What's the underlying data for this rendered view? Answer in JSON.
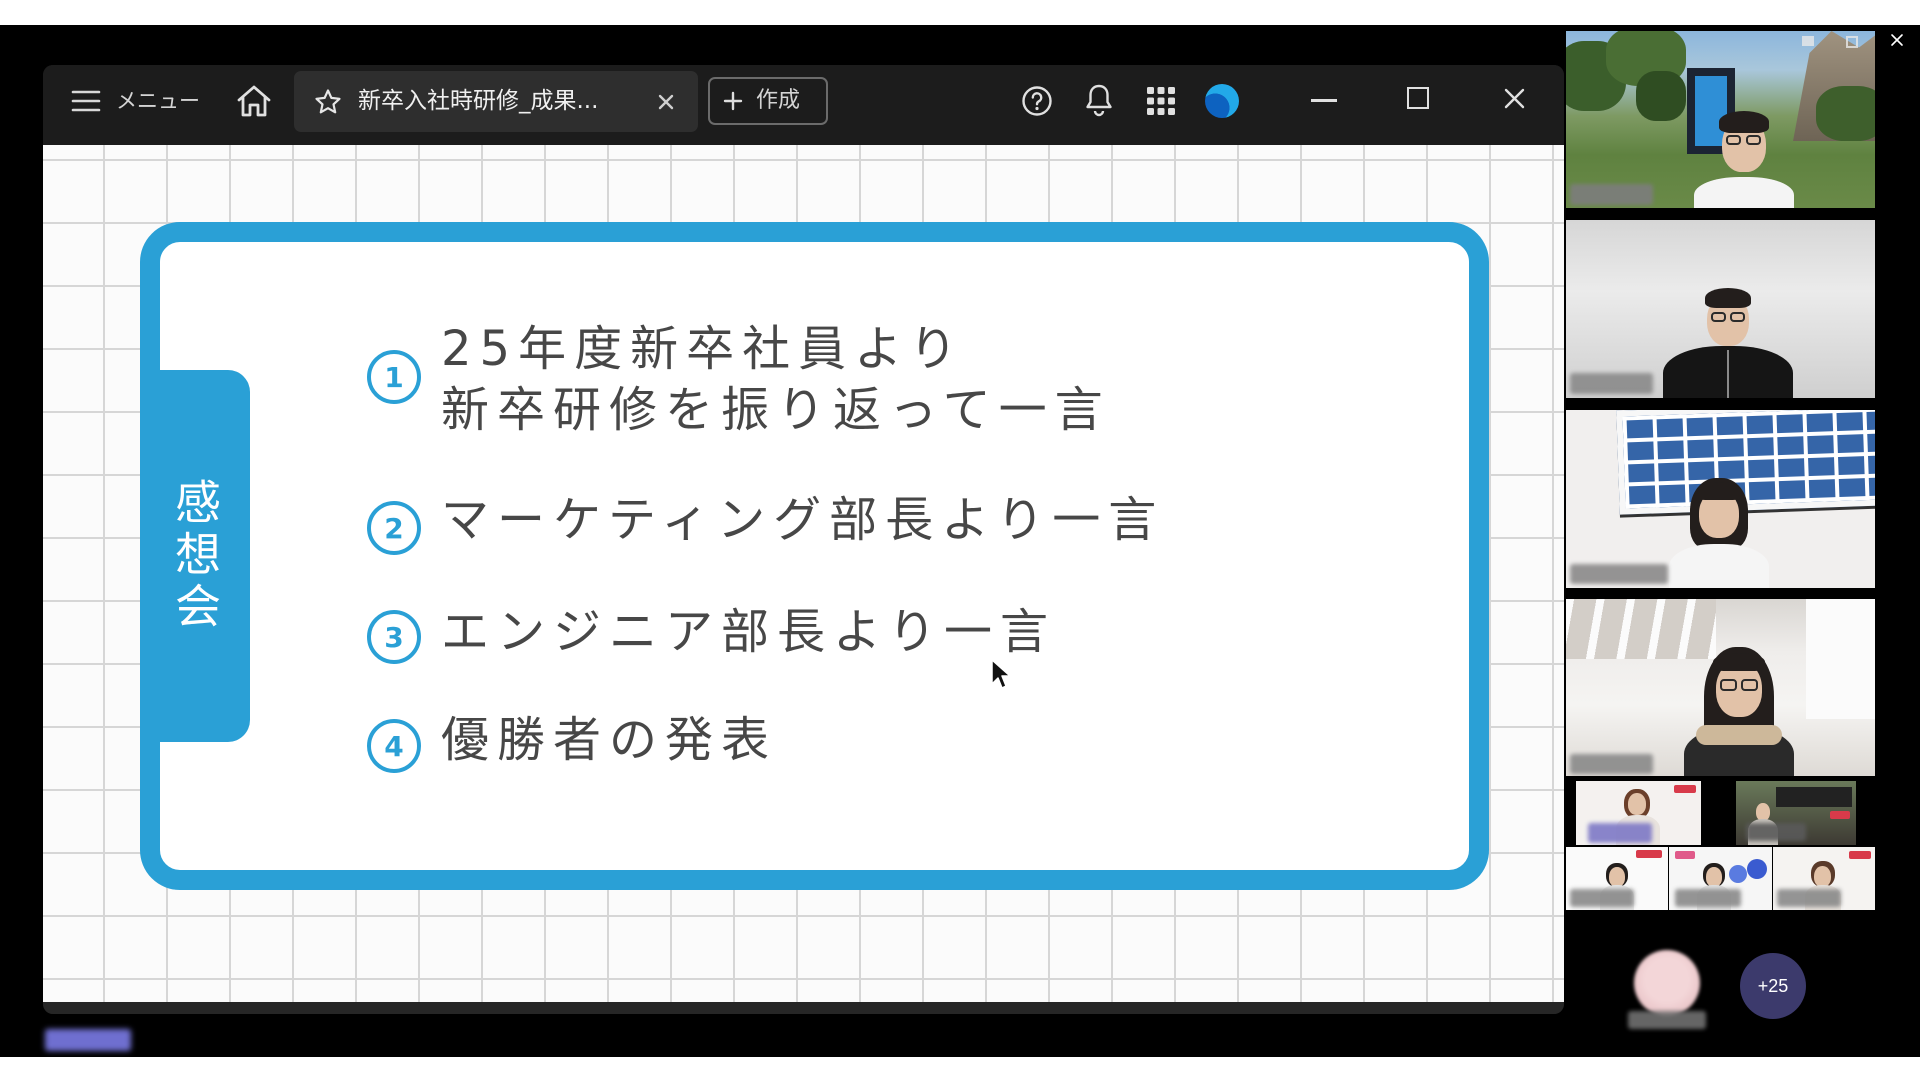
{
  "window": {
    "menu_label": "メニュー",
    "active_tab": {
      "title": "新卒入社時研修_成果...",
      "favorite_icon": "star-icon",
      "close_icon": "close-icon"
    },
    "create_button": {
      "label": "作成",
      "icon": "plus-icon"
    },
    "toolbar_icons": [
      "menu-icon",
      "home-icon",
      "help-icon",
      "bell-icon",
      "apps-grid-icon",
      "account-avatar-icon"
    ],
    "window_controls": [
      "minimize-icon",
      "maximize-icon",
      "close-icon"
    ]
  },
  "slide": {
    "side_label": "感想会",
    "items": [
      {
        "number": "1",
        "lines": [
          "25年度新卒社員より",
          "新卒研修を振り返って一言"
        ]
      },
      {
        "number": "2",
        "lines": [
          "マーケティング部長より一言"
        ]
      },
      {
        "number": "3",
        "lines": [
          "エンジニア部長より一言"
        ]
      },
      {
        "number": "4",
        "lines": [
          "優勝者の発表"
        ]
      }
    ]
  },
  "participants": {
    "overflow_count": "+25"
  },
  "colors": {
    "accent": "#2aa0d6",
    "titlebar": "#1c1c1c",
    "slide_text": "#474747",
    "participant_badge": "#3c3a6c"
  }
}
